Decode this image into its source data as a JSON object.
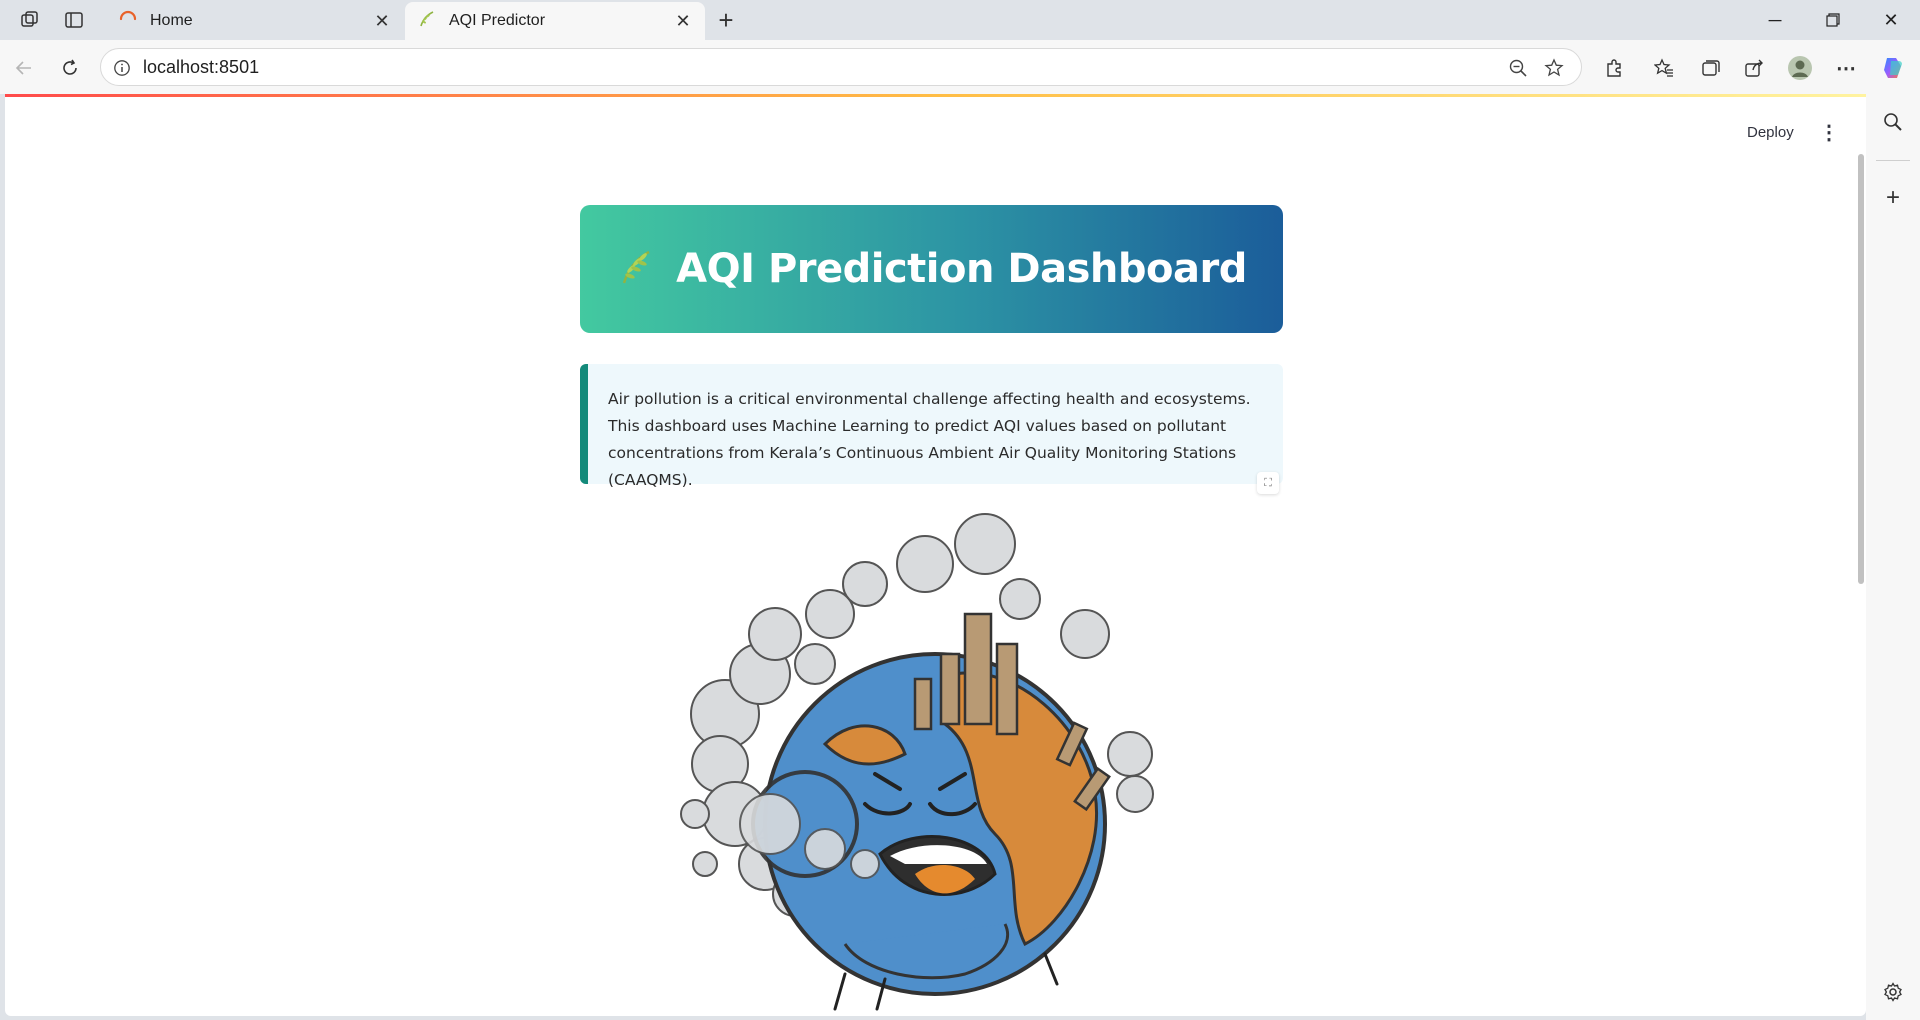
{
  "browser": {
    "tabs": [
      {
        "title": "Home",
        "active": false
      },
      {
        "title": "AQI Predictor",
        "active": true
      }
    ],
    "address": "localhost:8501"
  },
  "app": {
    "deploy_label": "Deploy",
    "title": "AQI Prediction Dashboard",
    "intro": "Air pollution is a critical environmental challenge affecting health and ecosystems. This dashboard uses Machine Learning to predict AQI values based on pollutant concentrations from Kerala’s Continuous Ambient Air Quality Monitoring Stations (CAAQMS).",
    "image_icon": "polluted-earth-illustration",
    "colors": {
      "hero_start": "#43c9a0",
      "hero_end": "#1b5d9a",
      "info_bg": "#eef8fc",
      "info_border": "#138a7a"
    }
  }
}
